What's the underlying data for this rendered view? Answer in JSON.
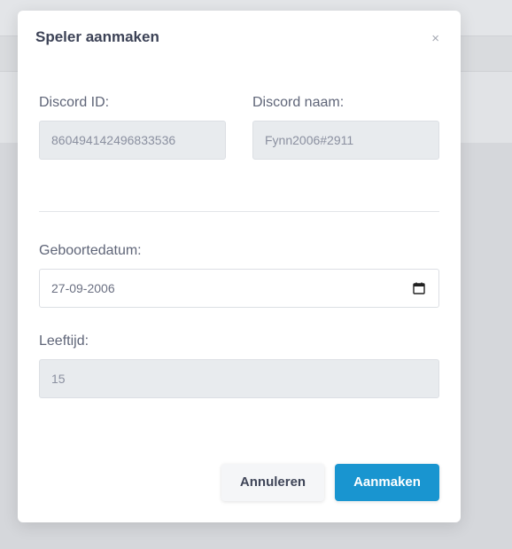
{
  "modal": {
    "title": "Speler aanmaken",
    "close_symbol": "×"
  },
  "fields": {
    "discord_id": {
      "label": "Discord ID:",
      "value": "860494142496833536",
      "disabled": true
    },
    "discord_name": {
      "label": "Discord naam:",
      "value": "Fynn2006#2911",
      "disabled": true
    },
    "birthdate": {
      "label": "Geboortedatum:",
      "value": "27-09-2006",
      "icon": "calendar-icon"
    },
    "age": {
      "label": "Leeftijd:",
      "value": "15",
      "disabled": true
    }
  },
  "actions": {
    "cancel_label": "Annuleren",
    "create_label": "Aanmaken"
  },
  "colors": {
    "primary": "#1995d0",
    "disabled_bg": "#e8ebee",
    "title": "#3c4256"
  }
}
